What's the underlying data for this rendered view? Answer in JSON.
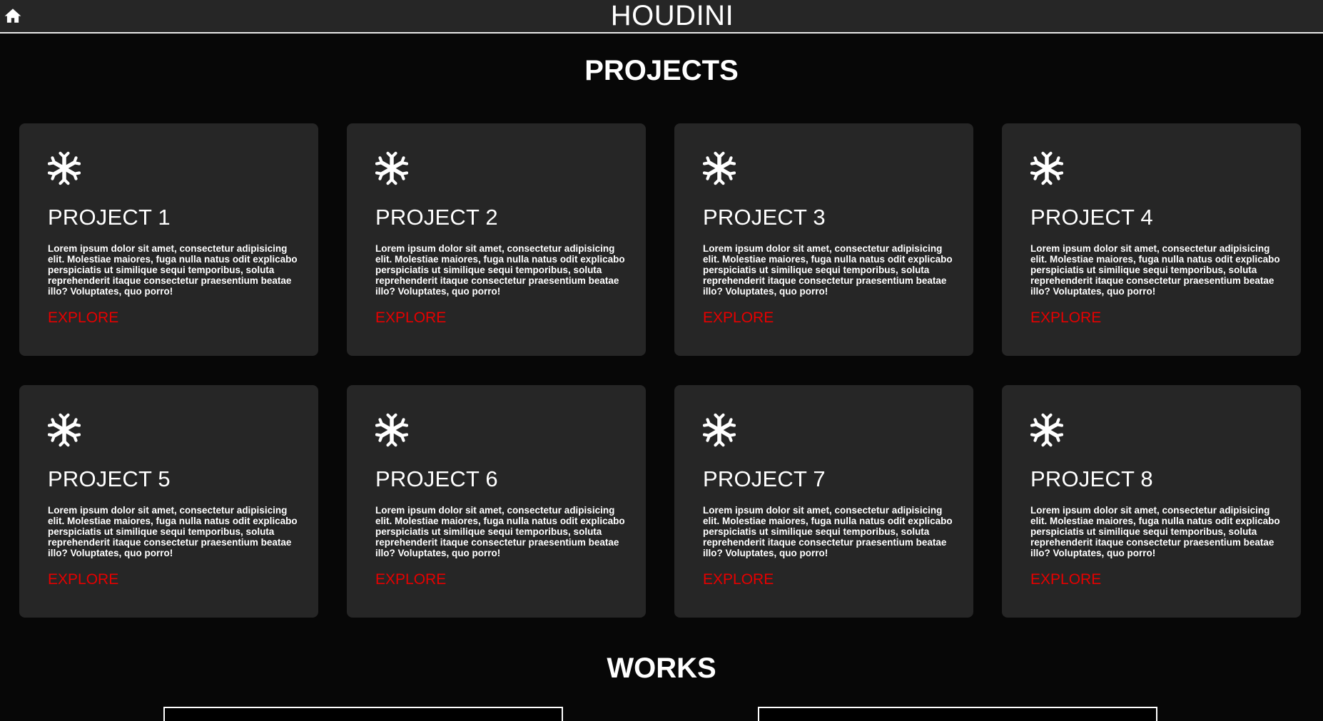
{
  "header": {
    "brand": "HOUDINI",
    "home_icon": "home-icon"
  },
  "projects": {
    "title": "PROJECTS",
    "items": [
      {
        "title": "PROJECT 1",
        "text": "Lorem ipsum dolor sit amet, consectetur adipisicing elit. Molestiae maiores, fuga nulla natus odit explicabo perspiciatis ut similique sequi temporibus, soluta reprehenderit itaque consectetur praesentium beatae illo? Voluptates, quo porro!",
        "link": "EXPLORE",
        "icon": "snowflake-icon"
      },
      {
        "title": "PROJECT 2",
        "text": "Lorem ipsum dolor sit amet, consectetur adipisicing elit. Molestiae maiores, fuga nulla natus odit explicabo perspiciatis ut similique sequi temporibus, soluta reprehenderit itaque consectetur praesentium beatae illo? Voluptates, quo porro!",
        "link": "EXPLORE",
        "icon": "snowflake-icon"
      },
      {
        "title": "PROJECT 3",
        "text": "Lorem ipsum dolor sit amet, consectetur adipisicing elit. Molestiae maiores, fuga nulla natus odit explicabo perspiciatis ut similique sequi temporibus, soluta reprehenderit itaque consectetur praesentium beatae illo? Voluptates, quo porro!",
        "link": "EXPLORE",
        "icon": "snowflake-icon"
      },
      {
        "title": "PROJECT 4",
        "text": "Lorem ipsum dolor sit amet, consectetur adipisicing elit. Molestiae maiores, fuga nulla natus odit explicabo perspiciatis ut similique sequi temporibus, soluta reprehenderit itaque consectetur praesentium beatae illo? Voluptates, quo porro!",
        "link": "EXPLORE",
        "icon": "snowflake-icon"
      },
      {
        "title": "PROJECT 5",
        "text": "Lorem ipsum dolor sit amet, consectetur adipisicing elit. Molestiae maiores, fuga nulla natus odit explicabo perspiciatis ut similique sequi temporibus, soluta reprehenderit itaque consectetur praesentium beatae illo? Voluptates, quo porro!",
        "link": "EXPLORE",
        "icon": "snowflake-icon"
      },
      {
        "title": "PROJECT 6",
        "text": "Lorem ipsum dolor sit amet, consectetur adipisicing elit. Molestiae maiores, fuga nulla natus odit explicabo perspiciatis ut similique sequi temporibus, soluta reprehenderit itaque consectetur praesentium beatae illo? Voluptates, quo porro!",
        "link": "EXPLORE",
        "icon": "snowflake-icon"
      },
      {
        "title": "PROJECT 7",
        "text": "Lorem ipsum dolor sit amet, consectetur adipisicing elit. Molestiae maiores, fuga nulla natus odit explicabo perspiciatis ut similique sequi temporibus, soluta reprehenderit itaque consectetur praesentium beatae illo? Voluptates, quo porro!",
        "link": "EXPLORE",
        "icon": "snowflake-icon"
      },
      {
        "title": "PROJECT 8",
        "text": "Lorem ipsum dolor sit amet, consectetur adipisicing elit. Molestiae maiores, fuga nulla natus odit explicabo perspiciatis ut similique sequi temporibus, soluta reprehenderit itaque consectetur praesentium beatae illo? Voluptates, quo porro!",
        "link": "EXPLORE",
        "icon": "snowflake-icon"
      }
    ]
  },
  "works": {
    "title": "WORKS"
  },
  "colors": {
    "background": "#070707",
    "card": "#262626",
    "accent": "#e60000",
    "text": "#ffffff"
  }
}
